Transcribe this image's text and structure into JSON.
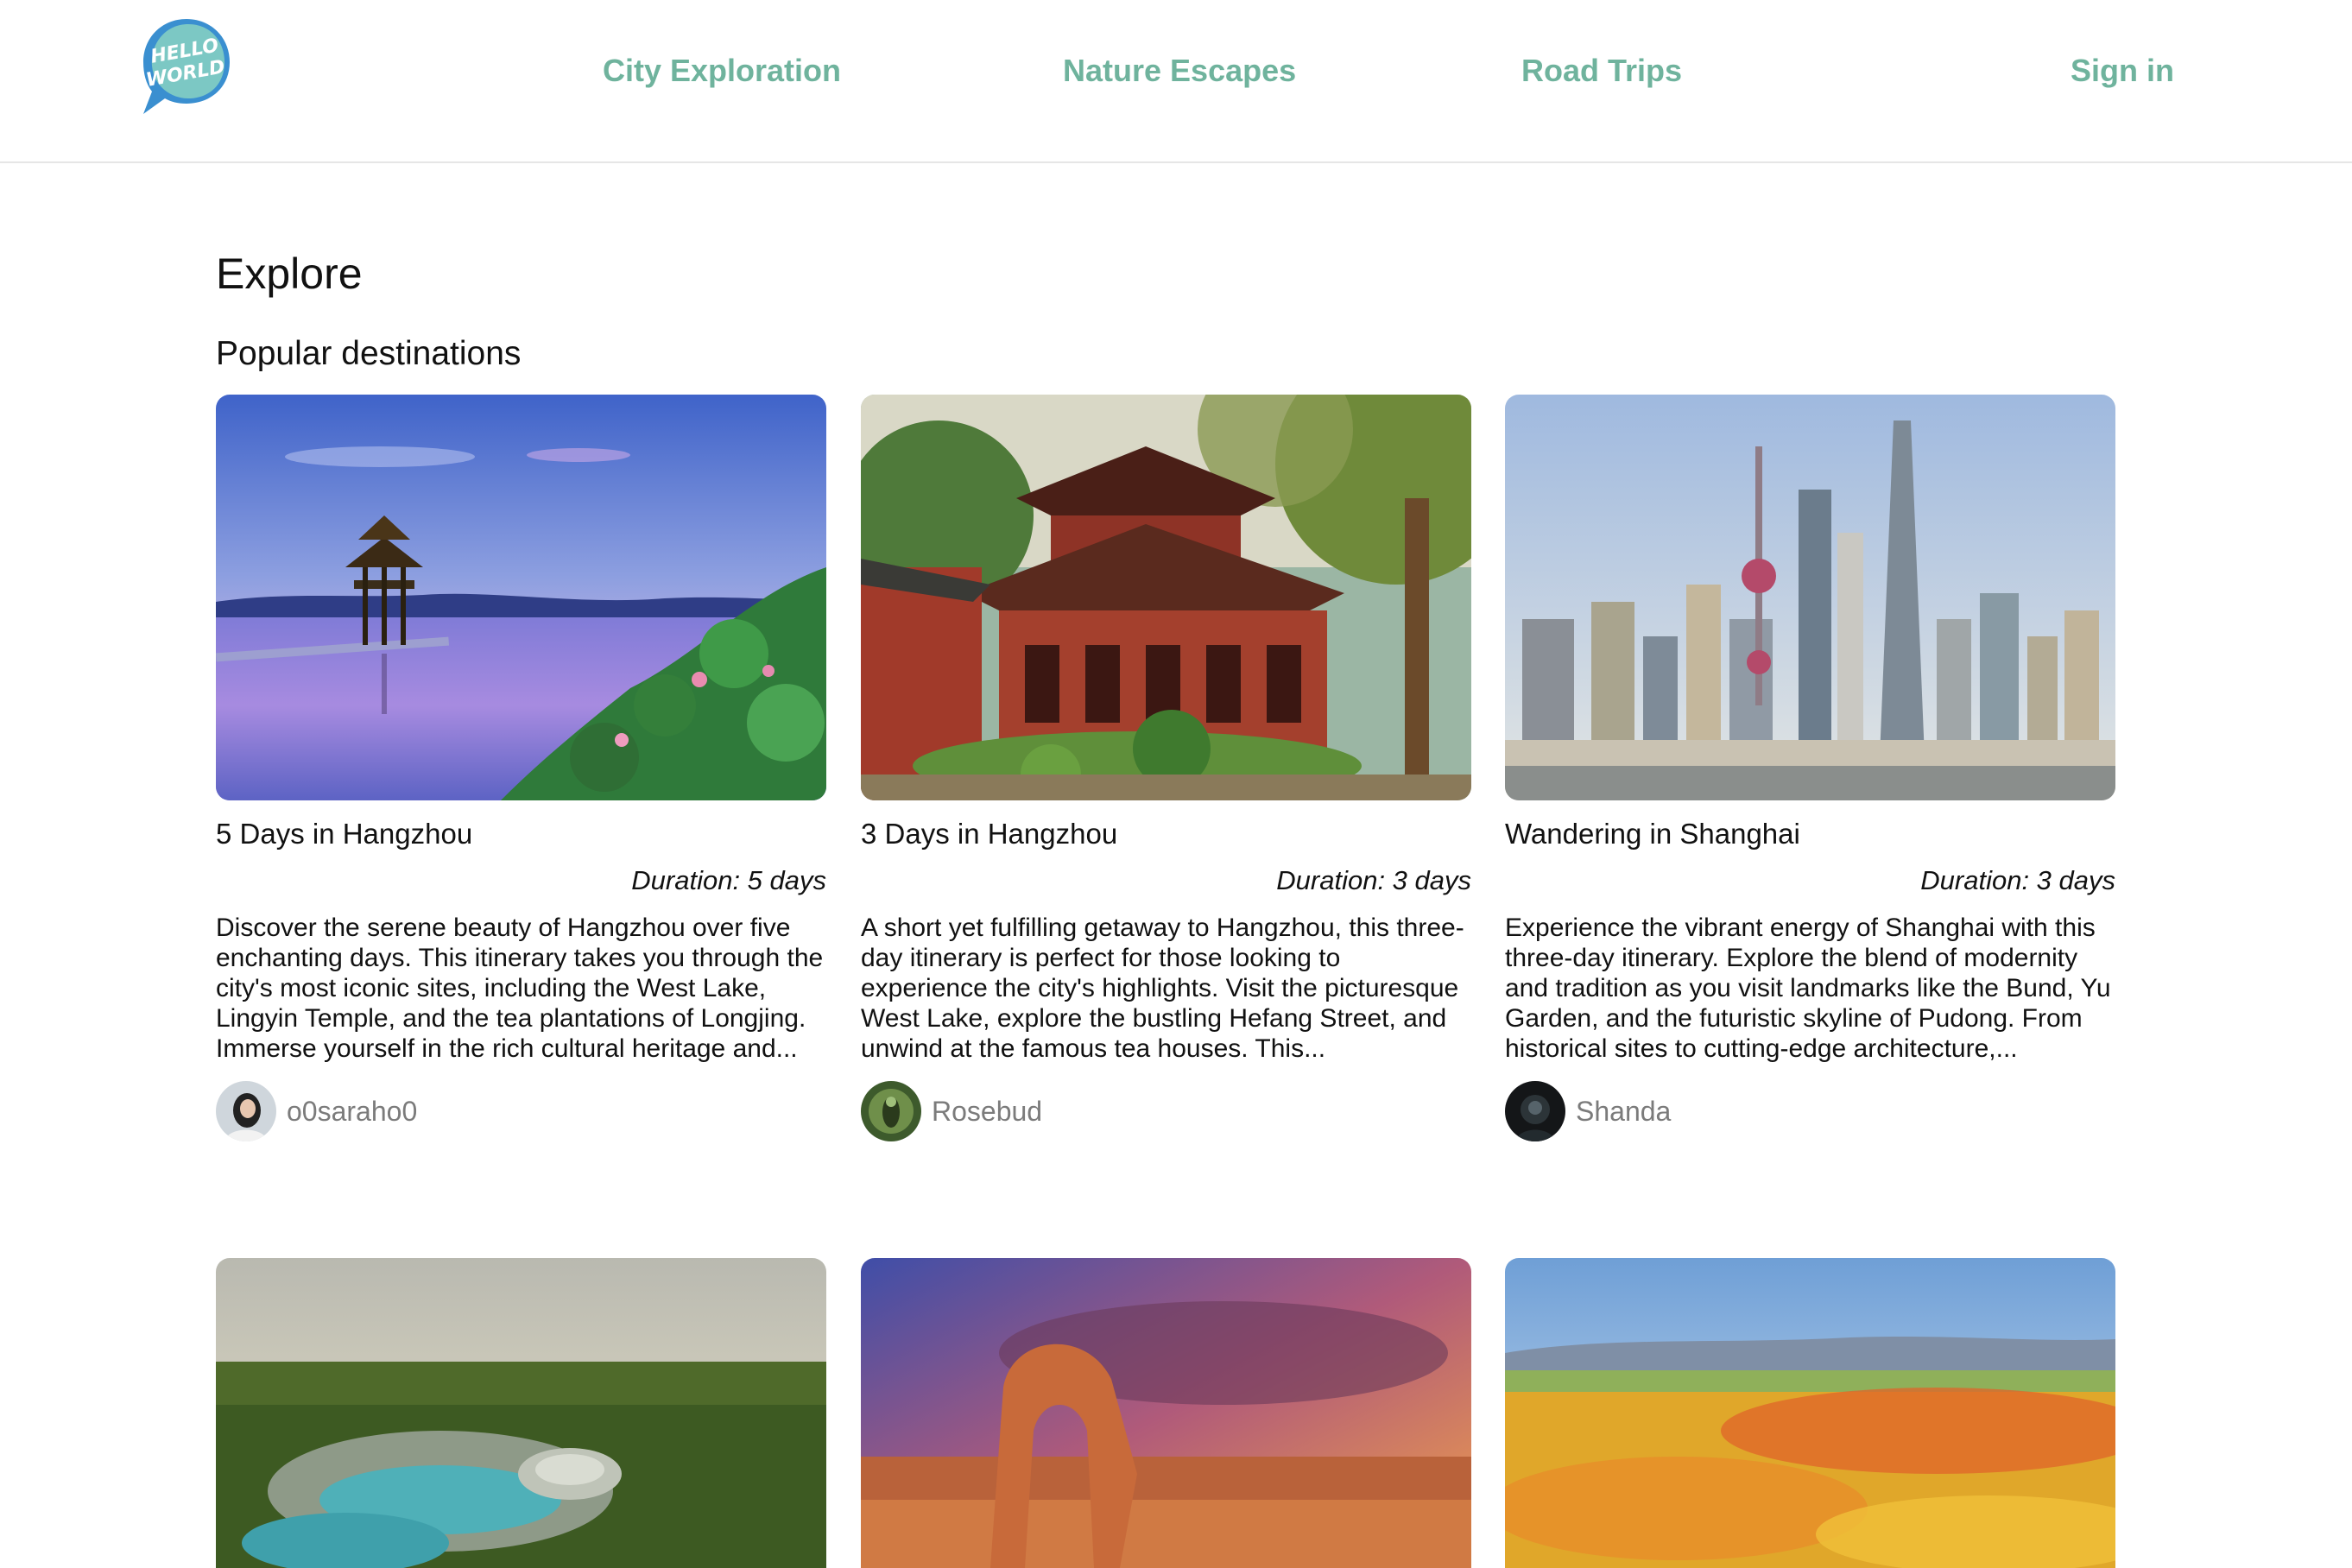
{
  "header": {
    "logo_text_line1": "HELLO",
    "logo_text_line2": "WORLD",
    "logo_icon": "speech-bubble-logo",
    "nav": [
      {
        "label": "City Exploration"
      },
      {
        "label": "Nature Escapes"
      },
      {
        "label": "Road Trips"
      }
    ],
    "sign_in_label": "Sign in"
  },
  "main": {
    "title": "Explore",
    "section_title": "Popular destinations",
    "cards": [
      {
        "title": "5 Days in Hangzhou",
        "duration": "Duration: 5 days",
        "description": "Discover the serene beauty of Hangzhou over five enchanting days. This itinerary takes you through the city's most iconic sites, including the West Lake, Lingyin Temple, and the tea plantations of Longjing. Immerse yourself in the rich cultural heritage and...",
        "author": "o0saraho0",
        "image_icon": "west-lake-pavilion-photo"
      },
      {
        "title": "3 Days in Hangzhou",
        "duration": "Duration: 3 days",
        "description": "A short yet fulfilling getaway to Hangzhou, this three-day itinerary is perfect for those looking to experience the city's highlights. Visit the picturesque West Lake, explore the bustling Hefang Street, and unwind at the famous tea houses. This...",
        "author": "Rosebud",
        "image_icon": "temple-photo"
      },
      {
        "title": "Wandering in Shanghai",
        "duration": "Duration: 3 days",
        "description": "Experience the vibrant energy of Shanghai with this three-day itinerary. Explore the blend of modernity and tradition as you visit landmarks like the Bund, Yu Garden, and the futuristic skyline of Pudong. From historical sites to cutting-edge architecture,...",
        "author": "Shanda",
        "image_icon": "shanghai-skyline-photo"
      }
    ],
    "more_cards": [
      {
        "image_icon": "resort-aerial-photo"
      },
      {
        "image_icon": "desert-arch-photo"
      },
      {
        "image_icon": "poppy-field-photo"
      }
    ]
  },
  "colors": {
    "accent": "#6fb39d",
    "text": "#111111",
    "muted": "#7b7b7b",
    "divider": "#e6e6e6",
    "logo_blue": "#3a8fd0",
    "logo_teal": "#7cc8c4"
  }
}
